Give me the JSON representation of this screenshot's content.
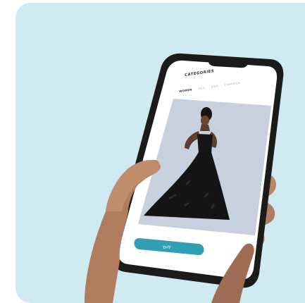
{
  "screen": {
    "categories_title": "CATEGORIES",
    "tabs": [
      {
        "label": "WOMEN",
        "active": true
      },
      {
        "label": "MEN",
        "active": false
      },
      {
        "label": "KIDS",
        "active": false
      },
      {
        "label": "CAMPAIGN",
        "active": false
      }
    ],
    "buy_label": "buy"
  },
  "colors": {
    "background": "#cfeaf0",
    "phone_frame": "#1a1a1a",
    "screen_photo_bg": "#c9d3df",
    "buy_button": "#2fa0b4",
    "skin": "#b07e5f"
  }
}
